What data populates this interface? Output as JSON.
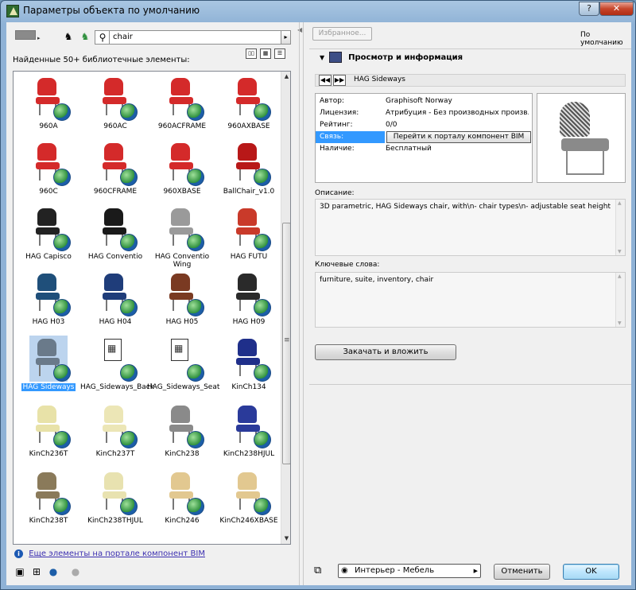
{
  "window": {
    "title": "Параметры объекта по умолчанию",
    "help": "?",
    "close": "✕"
  },
  "search": {
    "value": "chair",
    "go": "▸"
  },
  "left": {
    "found_label": "Найденные 50+ библиотечные элементы:",
    "bim_link": "Еще элементы на портале компонент BIM",
    "info_glyph": "i"
  },
  "items": [
    {
      "label": "960A",
      "color": "#d42a2a",
      "type": "chair"
    },
    {
      "label": "960AC",
      "color": "#d42a2a",
      "type": "chair"
    },
    {
      "label": "960ACFRAME",
      "color": "#d42a2a",
      "type": "chair"
    },
    {
      "label": "960AXBASE",
      "color": "#d42a2a",
      "type": "chair"
    },
    {
      "label": "960C",
      "color": "#d42a2a",
      "type": "chair"
    },
    {
      "label": "960CFRAME",
      "color": "#d42a2a",
      "type": "chair"
    },
    {
      "label": "960XBASE",
      "color": "#d42a2a",
      "type": "chair"
    },
    {
      "label": "BallChair_v1.0",
      "color": "#b81818",
      "type": "chair"
    },
    {
      "label": "HAG Capisco",
      "color": "#222222",
      "type": "chair"
    },
    {
      "label": "HAG Conventio",
      "color": "#1a1a1a",
      "type": "chair"
    },
    {
      "label": "HAG Conventio Wing",
      "color": "#9a9a9a",
      "type": "chair"
    },
    {
      "label": "HAG FUTU",
      "color": "#c93a2a",
      "type": "chair"
    },
    {
      "label": "HAG H03",
      "color": "#1f4f7a",
      "type": "chair"
    },
    {
      "label": "HAG H04",
      "color": "#1f3d7a",
      "type": "chair"
    },
    {
      "label": "HAG H05",
      "color": "#7a3a22",
      "type": "chair"
    },
    {
      "label": "HAG H09",
      "color": "#2a2a2a",
      "type": "chair"
    },
    {
      "label": "HAG Sideways",
      "color": "#6a7a8a",
      "type": "chair",
      "selected": true
    },
    {
      "label": "HAG_Sideways_Back",
      "color": "#ffffff",
      "type": "doc"
    },
    {
      "label": "HAG_Sideways_Seat",
      "color": "#ffffff",
      "type": "doc"
    },
    {
      "label": "KinCh134",
      "color": "#1f2f8a",
      "type": "chair"
    },
    {
      "label": "KinCh236T",
      "color": "#e8e2a8",
      "type": "chair"
    },
    {
      "label": "KinCh237T",
      "color": "#ece6b6",
      "type": "chair"
    },
    {
      "label": "KinCh238",
      "color": "#8a8a8a",
      "type": "chair"
    },
    {
      "label": "KinCh238HJUL",
      "color": "#2a3a9a",
      "type": "chair"
    },
    {
      "label": "KinCh238T",
      "color": "#8a7a5a",
      "type": "chair"
    },
    {
      "label": "KinCh238THJUL",
      "color": "#e8e2b0",
      "type": "chair"
    },
    {
      "label": "KinCh246",
      "color": "#e2c890",
      "type": "chair"
    },
    {
      "label": "KinCh246XBASE",
      "color": "#e2c890",
      "type": "chair"
    }
  ],
  "right": {
    "favorites": "Избранное...",
    "default": "По умолчанию",
    "section_title": "Просмотр и информация",
    "object_name": "HAG Sideways",
    "info": [
      {
        "key": "Автор:",
        "value": "Graphisoft Norway"
      },
      {
        "key": "Лицензия:",
        "value": "Атрибуция - Без производных произв..."
      },
      {
        "key": "Рейтинг:",
        "value": "0/0"
      },
      {
        "key": "Связь:",
        "value": "Перейти к порталу компонент BIM"
      },
      {
        "key": "Наличие:",
        "value": "Бесплатный"
      }
    ],
    "description_label": "Описание:",
    "description": "3D parametric, HAG Sideways chair, with\\n- chair types\\n- adjustable seat height",
    "keywords_label": "Ключевые слова:",
    "keywords": "furniture, suite, inventory, chair",
    "download_button": "Закачать и вложить",
    "layer": "Интерьер - Мебель",
    "cancel": "Отменить",
    "ok": "OK"
  },
  "colors": {
    "selection": "#3399ff",
    "globe": "#2d8f3c",
    "link": "#3c2fb0"
  }
}
